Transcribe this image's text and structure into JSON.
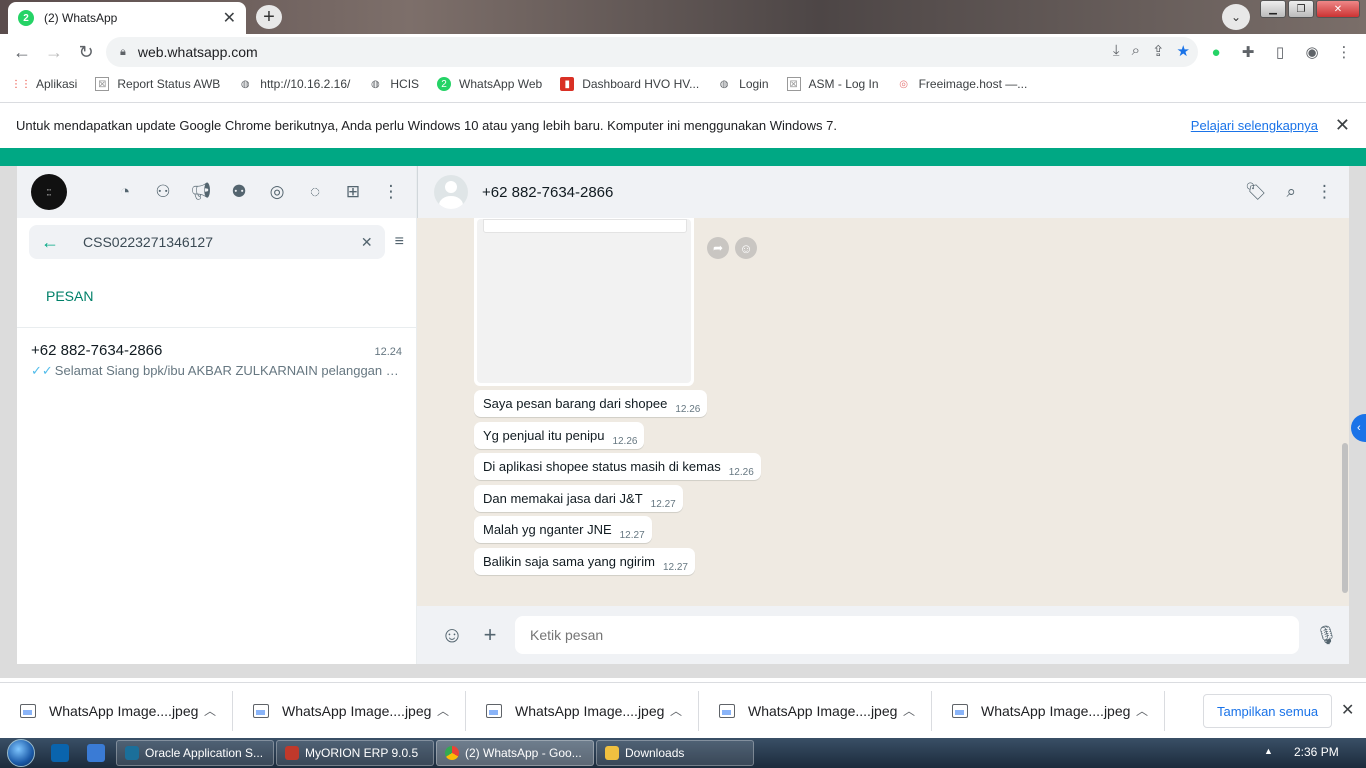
{
  "browser": {
    "tab_title": "(2) WhatsApp",
    "tab_badge": "2",
    "url": "web.whatsapp.com"
  },
  "bookmarks": [
    {
      "label": "Aplikasi",
      "icon": "apps-grid-icon"
    },
    {
      "label": "Report Status AWB",
      "icon": "broken-image-icon"
    },
    {
      "label": "http://10.16.2.16/",
      "icon": "globe-icon"
    },
    {
      "label": "HCIS",
      "icon": "globe-icon"
    },
    {
      "label": "WhatsApp Web",
      "icon": "whatsapp-icon"
    },
    {
      "label": "Dashboard HVO HV...",
      "icon": "dashboard-icon"
    },
    {
      "label": "Login",
      "icon": "globe-icon"
    },
    {
      "label": "ASM - Log In",
      "icon": "broken-image-icon"
    },
    {
      "label": "Freeimage.host —...",
      "icon": "freeimage-icon"
    }
  ],
  "infobar": {
    "message": "Untuk mendapatkan update Google Chrome berikutnya, Anda perlu Windows 10 atau yang lebih baru. Komputer ini menggunakan Windows 7.",
    "link": "Pelajari selengkapnya"
  },
  "whatsapp": {
    "search": {
      "value": "CSS0223271346127"
    },
    "section_label": "PESAN",
    "chat": {
      "name": "+62 882-7634-2866",
      "time": "12.24",
      "preview": "Selamat Siang   bpk/ibu AKBAR ZULKARNAIN pelanggan set..."
    },
    "conversation": {
      "contact": "+62 882-7634-2866",
      "messages": [
        {
          "text": "Saya pesan barang dari shopee",
          "time": "12.26"
        },
        {
          "text": "Yg penjual itu penipu",
          "time": "12.26"
        },
        {
          "text": "Di aplikasi shopee status masih di kemas",
          "time": "12.26"
        },
        {
          "text": "Dan memakai jasa dari J&T",
          "time": "12.27"
        },
        {
          "text": "Malah yg nganter JNE",
          "time": "12.27"
        },
        {
          "text": "Balikin saja sama yang ngirim",
          "time": "12.27"
        }
      ],
      "composer_placeholder": "Ketik pesan"
    }
  },
  "downloads": {
    "items": [
      "WhatsApp Image....jpeg",
      "WhatsApp Image....jpeg",
      "WhatsApp Image....jpeg",
      "WhatsApp Image....jpeg",
      "WhatsApp Image....jpeg"
    ],
    "show_all": "Tampilkan semua"
  },
  "taskbar": {
    "tasks": [
      "Oracle Application S...",
      "MyORION ERP 9.0.5",
      "(2) WhatsApp - Goo...",
      "Downloads"
    ],
    "clock": "2:36 PM"
  },
  "colors": {
    "whatsapp_green": "#00a884",
    "chrome_blue": "#1a73e8"
  }
}
